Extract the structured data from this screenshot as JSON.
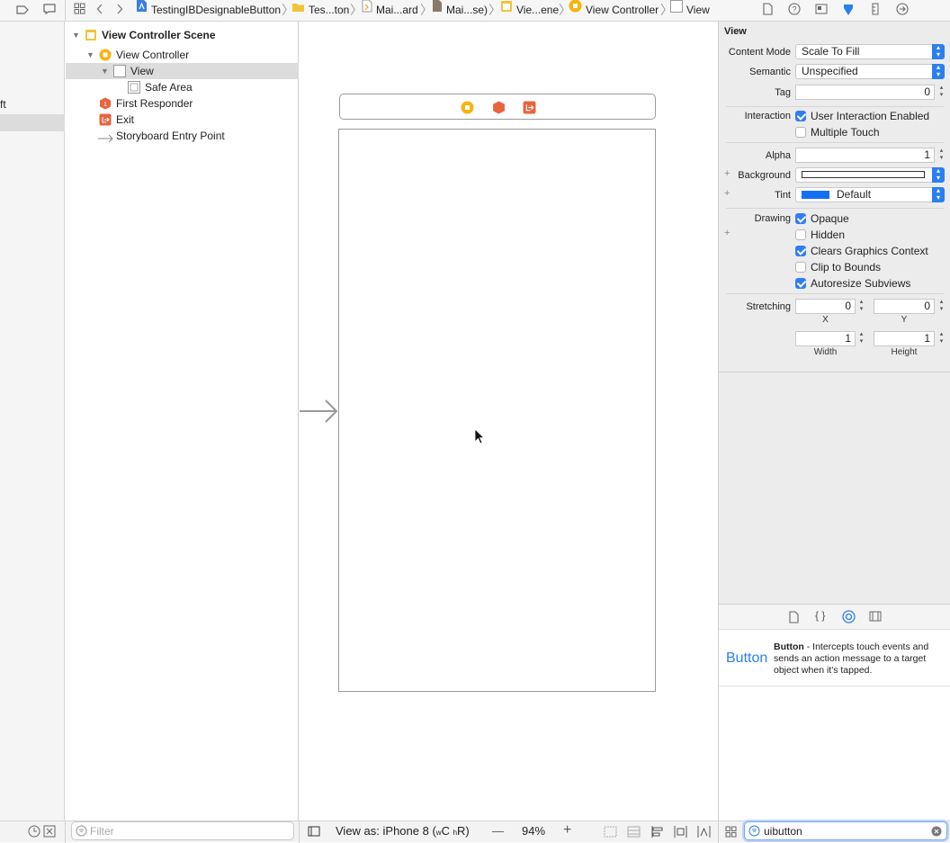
{
  "breadcrumb": [
    "TestingIBDesignableButton",
    "Tes...ton",
    "Mai...ard",
    "Mai...se)",
    "Vie...ene",
    "View Controller",
    "View"
  ],
  "leftnav": {
    "partial_text": "ft"
  },
  "outline": {
    "scene": "View Controller Scene",
    "controller": "View Controller",
    "view": "View",
    "safe_area": "Safe Area",
    "first_responder": "First Responder",
    "exit": "Exit",
    "entry_point": "Storyboard Entry Point"
  },
  "bottom": {
    "filter_placeholder": "Filter",
    "view_as": "View as: iPhone 8 (",
    "view_as_w": "w",
    "view_as_c": "C",
    "view_as_h": "h",
    "view_as_r": "R)",
    "minus": "—",
    "zoom": "94%",
    "plus": "+",
    "search_value": "uibutton"
  },
  "inspector": {
    "section_title": "View",
    "content_mode_label": "Content Mode",
    "content_mode_value": "Scale To Fill",
    "semantic_label": "Semantic",
    "semantic_value": "Unspecified",
    "tag_label": "Tag",
    "tag_value": "0",
    "interaction_label": "Interaction",
    "user_interaction": "User Interaction Enabled",
    "multiple_touch": "Multiple Touch",
    "alpha_label": "Alpha",
    "alpha_value": "1",
    "background_label": "Background",
    "tint_label": "Tint",
    "tint_value": "Default",
    "drawing_label": "Drawing",
    "opaque": "Opaque",
    "hidden": "Hidden",
    "clears_graphics": "Clears Graphics Context",
    "clip_bounds": "Clip to Bounds",
    "autoresize": "Autoresize Subviews",
    "stretching_label": "Stretching",
    "stretch_x_value": "0",
    "stretch_y_value": "0",
    "stretch_w_value": "1",
    "stretch_h_value": "1",
    "x_label": "X",
    "y_label": "Y",
    "width_label": "Width",
    "height_label": "Height",
    "plus": "+"
  },
  "library": {
    "item_name": "Button",
    "item_title": "Button",
    "item_desc": " - Intercepts touch events and sends an action message to a target object when it's tapped."
  },
  "colors": {
    "accent": "#2b7ff0",
    "tint_swatch": "#1470f0",
    "orange_icon": "#f0a020",
    "red_icon": "#e8643c"
  }
}
